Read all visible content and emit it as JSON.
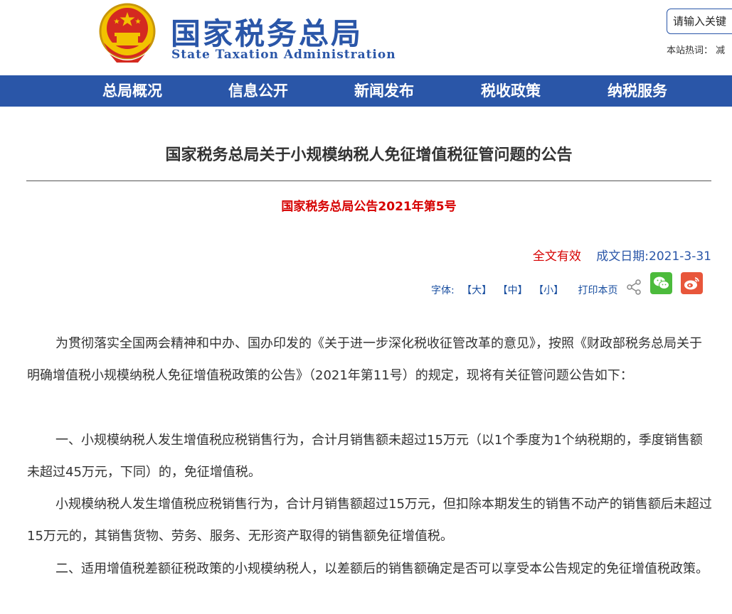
{
  "header": {
    "title_cn": "国家税务总局",
    "title_en": "State Taxation Administration",
    "search_placeholder": "请输入关键",
    "hot_words_label": "本站热词：",
    "hot_words_value": "减"
  },
  "nav": {
    "items": [
      "总局概况",
      "信息公开",
      "新闻发布",
      "税收政策",
      "纳税服务"
    ]
  },
  "article": {
    "title": "国家税务总局关于小规模纳税人免征增值税征管问题的公告",
    "doc_number": "国家税务总局公告2021年第5号",
    "status": "全文有效",
    "issue_date": "成文日期:2021-3-31",
    "tools": {
      "font_label": "字体:",
      "size_large": "【大】",
      "size_medium": "【中】",
      "size_small": "【小】",
      "print": "打印本页"
    },
    "paragraphs": [
      "为贯彻落实全国两会精神和中办、国办印发的《关于进一步深化税收征管改革的意见》，按照《财政部税务总局关于明确增值税小规模纳税人免征增值税政策的公告》（2021年第11号）的规定，现将有关征管问题公告如下：",
      "一、小规模纳税人发生增值税应税销售行为，合计月销售额未超过15万元（以1个季度为1个纳税期的，季度销售额未超过45万元，下同）的，免征增值税。",
      "小规模纳税人发生增值税应税销售行为，合计月销售额超过15万元，但扣除本期发生的销售不动产的销售额后未超过15万元的，其销售货物、劳务、服务、无形资产取得的销售额免征增值税。",
      "二、适用增值税差额征税政策的小规模纳税人，以差额后的销售额确定是否可以享受本公告规定的免征增值税政策。"
    ]
  },
  "colors": {
    "brand_blue": "#2a56a8",
    "status_red": "#d60000",
    "wechat_green": "#4cbb3c",
    "weibo_red": "#e8563b"
  },
  "icons": {
    "emblem": "national-emblem-icon",
    "share": "share-icon",
    "wechat": "wechat-icon",
    "weibo": "weibo-icon"
  }
}
